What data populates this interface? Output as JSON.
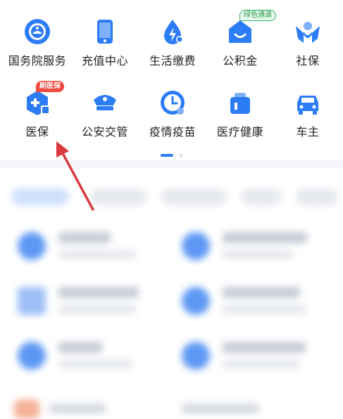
{
  "services_grid": {
    "items": [
      {
        "label": "国务院服务",
        "icon": "state-council-icon"
      },
      {
        "label": "充值中心",
        "icon": "phone-recharge-icon"
      },
      {
        "label": "生活缴费",
        "icon": "utility-payment-icon"
      },
      {
        "label": "公积金",
        "icon": "housing-fund-icon",
        "badge": "绿色通道"
      },
      {
        "label": "社保",
        "icon": "social-security-icon"
      },
      {
        "label": "医保",
        "icon": "medical-insurance-icon",
        "badge": "刷医保"
      },
      {
        "label": "公安交管",
        "icon": "police-traffic-icon"
      },
      {
        "label": "疫情疫苗",
        "icon": "vaccine-clock-icon"
      },
      {
        "label": "医疗健康",
        "icon": "healthcare-icon"
      },
      {
        "label": "车主",
        "icon": "car-owner-icon"
      }
    ],
    "pages": {
      "count": 2,
      "active": 1
    }
  },
  "colors": {
    "accent": "#2c7cf6",
    "badge_red": "#f04a3e",
    "badge_green": "#2cb25c",
    "annotation_arrow": "#d9393f",
    "section_divider": "#f3f5f8"
  }
}
